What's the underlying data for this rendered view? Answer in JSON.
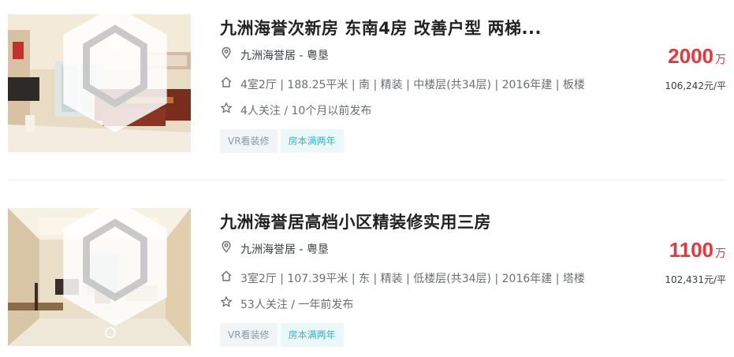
{
  "listings": [
    {
      "title": "九洲海誉次新房 东南4房 改善户型 两梯...",
      "community": "九洲海誉居",
      "separator": " - ",
      "district": "粤垦",
      "house_info": "4室2厅 | 188.25平米 | 南 | 精装 | 中楼层(共34层) | 2016年建 | 板楼",
      "follow_info": "4人关注 / 10个月以前发布",
      "tags": [
        "VR看装修",
        "房本满两年"
      ],
      "total_price": "2000",
      "price_unit": "万",
      "unit_price": "106,242元/平"
    },
    {
      "title": "九洲海誉居高档小区精装修实用三房",
      "community": "九洲海誉居",
      "separator": " - ",
      "district": "粤垦",
      "house_info": "3室2厅 | 107.39平米 | 东 | 精装 | 低楼层(共34层) | 2016年建 | 塔楼",
      "follow_info": "53人关注 / 一年前发布",
      "tags": [
        "VR看装修",
        "房本满两年"
      ],
      "total_price": "1100",
      "price_unit": "万",
      "unit_price": "102,431元/平"
    }
  ],
  "icons": {
    "location": "location-pin-icon",
    "house": "house-icon",
    "follow": "star-icon",
    "vr": "vr-badge-icon"
  },
  "colors": {
    "price": "#e4393c",
    "title": "#222222",
    "tag_vr_bg": "#f1f5f8",
    "tag_five_bg": "#eaf8f9"
  }
}
